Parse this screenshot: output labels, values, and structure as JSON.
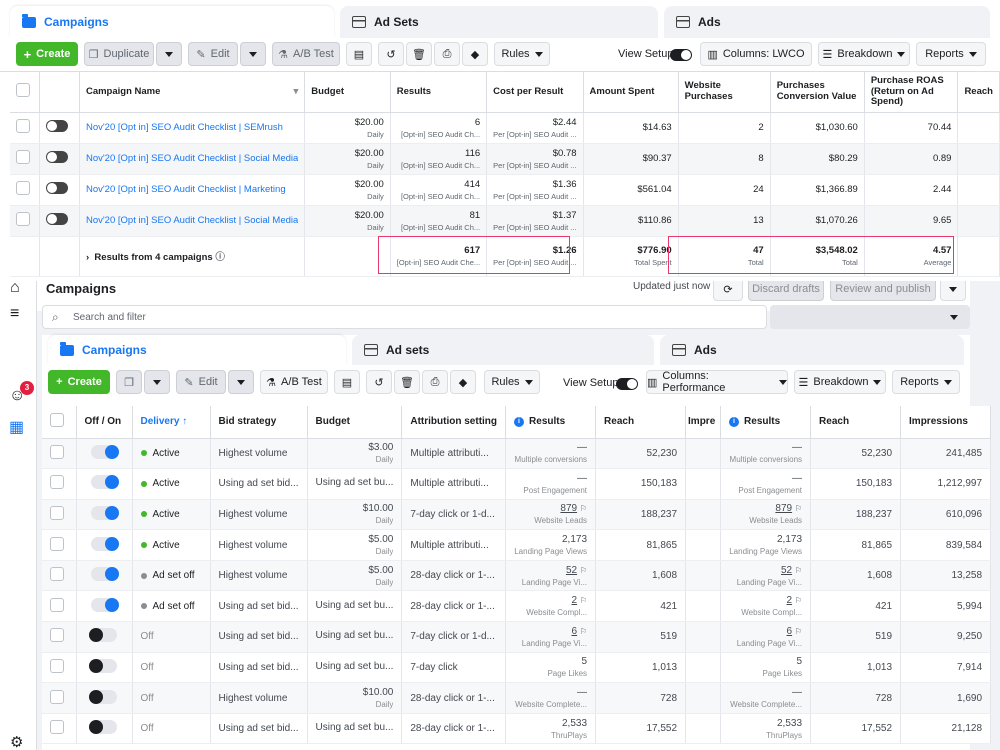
{
  "top": {
    "tabs": {
      "campaigns": "Campaigns",
      "adsets": "Ad Sets",
      "ads": "Ads"
    },
    "toolbar": {
      "create": "Create",
      "duplicate": "Duplicate",
      "edit": "Edit",
      "ab_test": "A/B Test",
      "rules": "Rules",
      "view_setup": "View Setup",
      "columns": "Columns: LWCO",
      "breakdown": "Breakdown",
      "reports": "Reports"
    },
    "columns": [
      "Campaign Name",
      "Budget",
      "Results",
      "Cost per Result",
      "Amount Spent",
      "Website Purchases",
      "Purchases Conversion Value",
      "Purchase ROAS (Return on Ad Spend)",
      "Reach"
    ],
    "rows": [
      {
        "name": "Nov'20 [Opt in] SEO Audit Checklist | SEMrush",
        "budget": "$20.00",
        "budget_sub": "Daily",
        "results": "6",
        "results_sub": "[Opt-in] SEO Audit Ch...",
        "cpr": "$2.44",
        "cpr_sub": "Per [Opt-in] SEO Audit ...",
        "spent": "$14.63",
        "purchases": "2",
        "conv_value": "$1,030.60",
        "roas": "70.44"
      },
      {
        "name": "Nov'20 [Opt in] SEO Audit Checklist | Social Media",
        "budget": "$20.00",
        "budget_sub": "Daily",
        "results": "116",
        "results_sub": "[Opt-in] SEO Audit Ch...",
        "cpr": "$0.78",
        "cpr_sub": "Per [Opt-in] SEO Audit ...",
        "spent": "$90.37",
        "purchases": "8",
        "conv_value": "$80.29",
        "roas": "0.89"
      },
      {
        "name": "Nov'20 [Opt in] SEO Audit Checklist | Marketing",
        "budget": "$20.00",
        "budget_sub": "Daily",
        "results": "414",
        "results_sub": "[Opt-in] SEO Audit Ch...",
        "cpr": "$1.36",
        "cpr_sub": "Per [Opt-in] SEO Audit ...",
        "spent": "$561.04",
        "purchases": "24",
        "conv_value": "$1,366.89",
        "roas": "2.44"
      },
      {
        "name": "Nov'20 [Opt in] SEO Audit Checklist | Social Media",
        "budget": "$20.00",
        "budget_sub": "Daily",
        "results": "81",
        "results_sub": "[Opt-in] SEO Audit Ch...",
        "cpr": "$1.37",
        "cpr_sub": "Per [Opt-in] SEO Audit ...",
        "spent": "$110.86",
        "purchases": "13",
        "conv_value": "$1,070.26",
        "roas": "9.65"
      }
    ],
    "summary": {
      "label": "Results from 4 campaigns",
      "results": "617",
      "results_sub": "[Opt-in] SEO Audit Che...",
      "cpr": "$1.26",
      "cpr_sub": "Per [Opt-in] SEO Audit ...",
      "spent": "$776.90",
      "spent_sub": "Total Spent",
      "purchases": "47",
      "purchases_sub": "Total",
      "conv_value": "$3,548.02",
      "conv_value_sub": "Total",
      "roas": "4.57",
      "roas_sub": "Average"
    }
  },
  "bottom": {
    "title": "Campaigns",
    "updated": "Updated just now",
    "discard": "Discard drafts",
    "review": "Review and publish",
    "search_placeholder": "Search and filter",
    "notifications": "3",
    "tabs": {
      "campaigns": "Campaigns",
      "adsets": "Ad sets",
      "ads": "Ads"
    },
    "toolbar": {
      "create": "Create",
      "edit": "Edit",
      "ab_test": "A/B Test",
      "rules": "Rules",
      "view_setup": "View Setup",
      "columns": "Columns: Performance",
      "breakdown": "Breakdown",
      "reports": "Reports"
    },
    "columns": [
      "Off / On",
      "Delivery ↑",
      "Bid strategy",
      "Budget",
      "Attribution setting",
      "Results",
      "Reach",
      "Impre",
      "Results",
      "Reach",
      "Impressions"
    ],
    "rows": [
      {
        "on": true,
        "delivery": "Active",
        "status": "active",
        "bid": "Highest volume",
        "budget": "$3.00",
        "budget_sub": "Daily",
        "attr": "Multiple attributi...",
        "results": "—",
        "results_sub": "Multiple conversions",
        "flag": false,
        "reach": "52,230",
        "results2": "—",
        "results2_sub": "Multiple conversions",
        "reach2": "52,230",
        "impr": "241,485"
      },
      {
        "on": true,
        "delivery": "Active",
        "status": "active",
        "bid": "Using ad set bid...",
        "budget": "Using ad set bu...",
        "budget_sub": "",
        "attr": "Multiple attributi...",
        "results": "—",
        "results_sub": "Post Engagement",
        "flag": false,
        "reach": "150,183",
        "results2": "—",
        "results2_sub": "Post Engagement",
        "reach2": "150,183",
        "impr": "1,212,997"
      },
      {
        "on": true,
        "delivery": "Active",
        "status": "active",
        "bid": "Highest volume",
        "budget": "$10.00",
        "budget_sub": "Daily",
        "attr": "7-day click or 1-d...",
        "results": "879",
        "results_sub": "Website Leads",
        "flag": true,
        "reach": "188,237",
        "results2": "879",
        "results2_sub": "Website Leads",
        "reach2": "188,237",
        "impr": "610,096"
      },
      {
        "on": true,
        "delivery": "Active",
        "status": "active",
        "bid": "Highest volume",
        "budget": "$5.00",
        "budget_sub": "Daily",
        "attr": "Multiple attributi...",
        "results": "2,173",
        "results_sub": "Landing Page Views",
        "flag": false,
        "reach": "81,865",
        "results2": "2,173",
        "results2_sub": "Landing Page Views",
        "reach2": "81,865",
        "impr": "839,584"
      },
      {
        "on": true,
        "delivery": "Ad set off",
        "status": "adsetoff",
        "bid": "Highest volume",
        "budget": "$5.00",
        "budget_sub": "Daily",
        "attr": "28-day click or 1-...",
        "results": "52",
        "results_sub": "Landing Page Vi...",
        "flag": true,
        "reach": "1,608",
        "results2": "52",
        "results2_sub": "Landing Page Vi...",
        "reach2": "1,608",
        "impr": "13,258"
      },
      {
        "on": true,
        "delivery": "Ad set off",
        "status": "adsetoff",
        "bid": "Using ad set bid...",
        "budget": "Using ad set bu...",
        "budget_sub": "",
        "attr": "28-day click or 1-...",
        "results": "2",
        "results_sub": "Website Compl...",
        "flag": true,
        "reach": "421",
        "results2": "2",
        "results2_sub": "Website Compl...",
        "reach2": "421",
        "impr": "5,994"
      },
      {
        "on": false,
        "delivery": "Off",
        "status": "off",
        "bid": "Using ad set bid...",
        "budget": "Using ad set bu...",
        "budget_sub": "",
        "attr": "7-day click or 1-d...",
        "results": "6",
        "results_sub": "Landing Page Vi...",
        "flag": true,
        "reach": "519",
        "results2": "6",
        "results2_sub": "Landing Page Vi...",
        "reach2": "519",
        "impr": "9,250"
      },
      {
        "on": false,
        "delivery": "Off",
        "status": "off",
        "bid": "Using ad set bid...",
        "budget": "Using ad set bu...",
        "budget_sub": "",
        "attr": "7-day click",
        "results": "5",
        "results_sub": "Page Likes",
        "flag": false,
        "reach": "1,013",
        "results2": "5",
        "results2_sub": "Page Likes",
        "reach2": "1,013",
        "impr": "7,914"
      },
      {
        "on": false,
        "delivery": "Off",
        "status": "off",
        "bid": "Highest volume",
        "budget": "$10.00",
        "budget_sub": "Daily",
        "attr": "28-day click or 1-...",
        "results": "—",
        "results_sub": "Website Complete...",
        "flag": false,
        "reach": "728",
        "results2": "—",
        "results2_sub": "Website Complete...",
        "reach2": "728",
        "impr": "1,690"
      },
      {
        "on": false,
        "delivery": "Off",
        "status": "off",
        "bid": "Using ad set bid...",
        "budget": "Using ad set bu...",
        "budget_sub": "",
        "attr": "28-day click or 1-...",
        "results": "2,533",
        "results_sub": "ThruPlays",
        "flag": false,
        "reach": "17,552",
        "results2": "2,533",
        "results2_sub": "ThruPlays",
        "reach2": "17,552",
        "impr": "21,128"
      }
    ]
  },
  "colors": {
    "accent": "#1877f2",
    "create_green": "#42b72a",
    "highlight": "#e8396d",
    "active_dot": "#42b72a",
    "off_dot": "#8a8d91",
    "badge": "#e41e3f"
  }
}
